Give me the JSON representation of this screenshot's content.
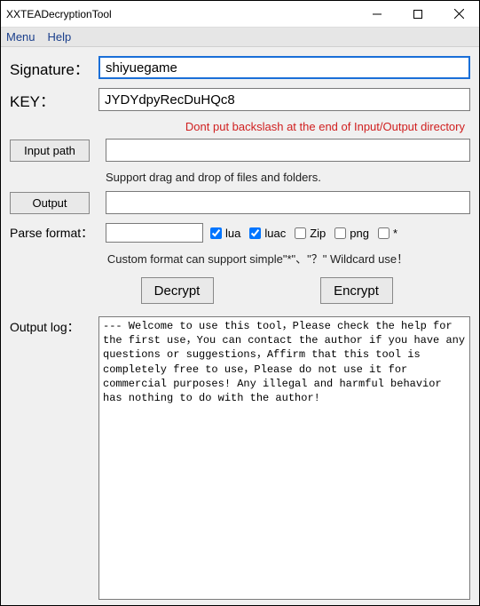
{
  "window": {
    "title": "XXTEADecryptionTool"
  },
  "menu": {
    "items": [
      "Menu",
      "Help"
    ]
  },
  "form": {
    "signature_label": "Signature：",
    "signature_value": "shiyuegame",
    "key_label": "KEY：",
    "key_value": "JYDYdpyRecDuHQc8",
    "warning": "Dont put backslash at the end of Input/Output directory",
    "input_path_button": "Input path",
    "input_path_value": "",
    "drag_hint": "Support drag and drop of files and folders.",
    "output_button": "Output",
    "output_value": "",
    "format_label": "Parse format：",
    "format_value": "",
    "checkboxes": [
      {
        "label": "lua",
        "checked": true
      },
      {
        "label": "luac",
        "checked": true
      },
      {
        "label": "Zip",
        "checked": false
      },
      {
        "label": "png",
        "checked": false
      },
      {
        "label": "*",
        "checked": false
      }
    ],
    "format_hint": "Custom format can support simple\"*\"、\"？\" Wildcard use！",
    "decrypt_button": "Decrypt",
    "encrypt_button": "Encrypt"
  },
  "log": {
    "label": "Output log：",
    "content": "--- Welcome to use this tool，Please check the help for the first use，You can contact the author if you have any questions or suggestions，Affirm that this tool is completely free to use，Please do not use it for commercial purposes! Any illegal and harmful behavior has nothing to do with the author!"
  }
}
